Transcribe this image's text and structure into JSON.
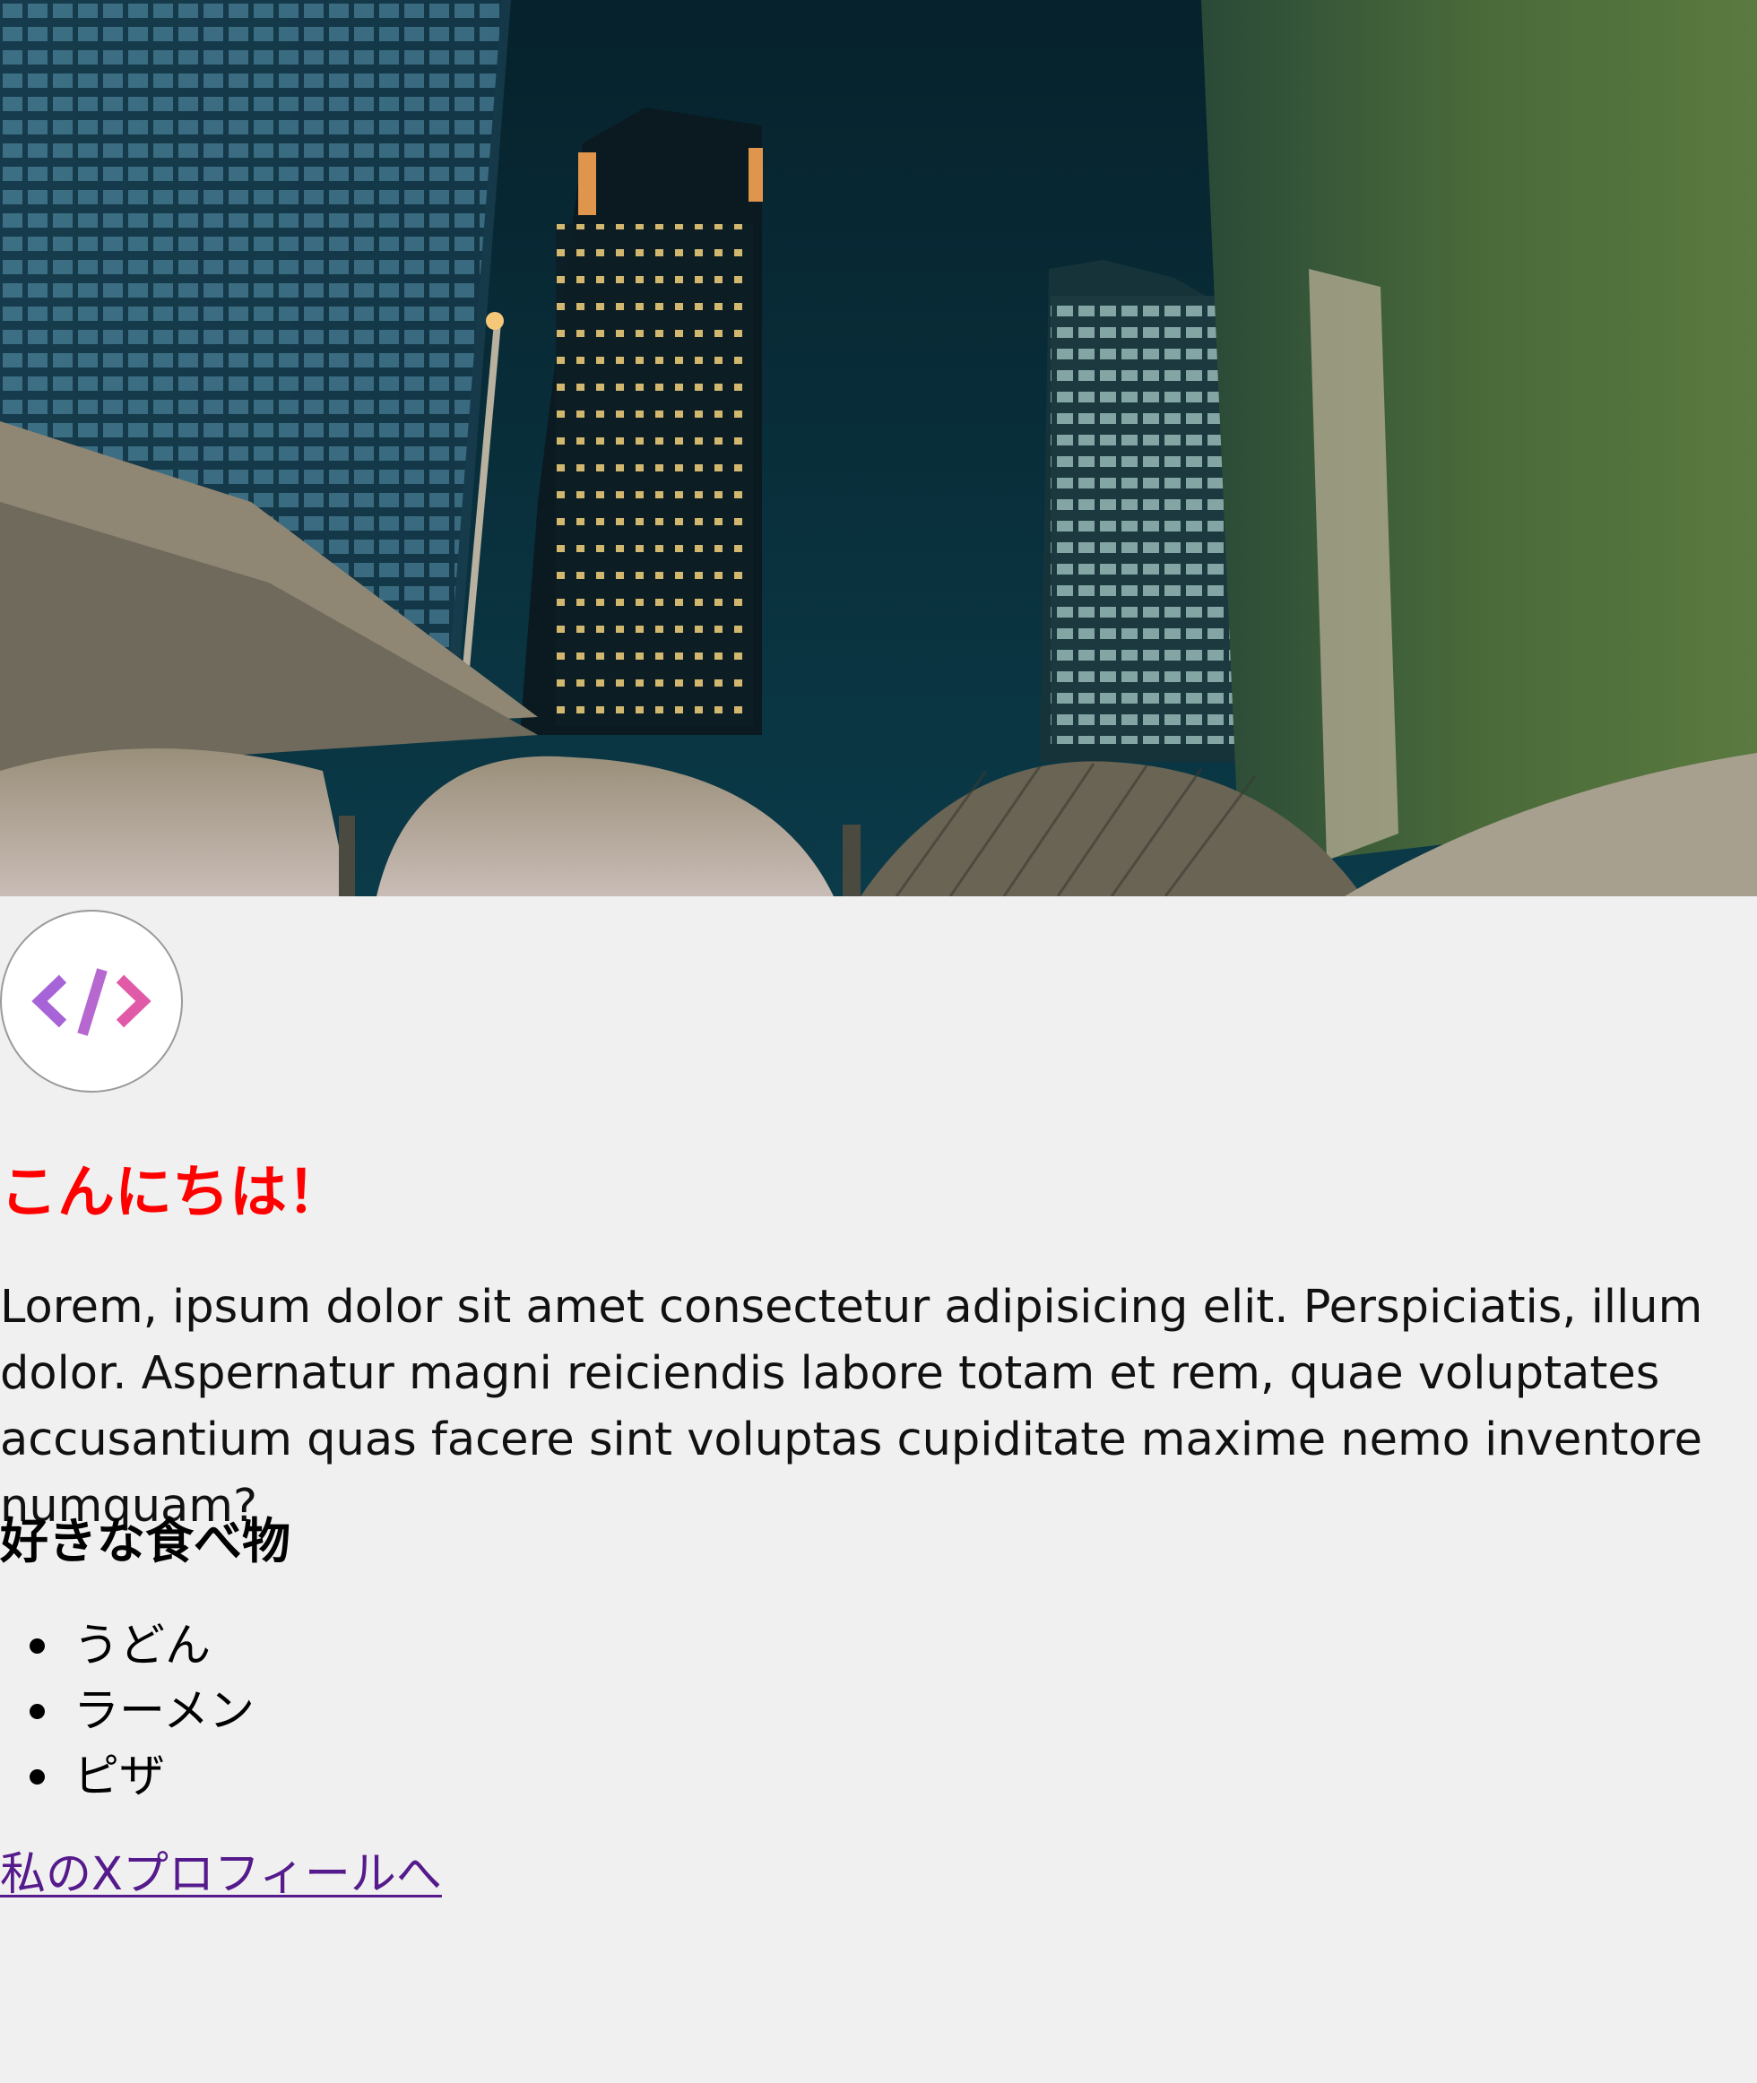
{
  "hero": {
    "image": "night-city-skyline-photo"
  },
  "avatar": {
    "icon": "code-brackets-icon",
    "glyph": "</>",
    "colors": {
      "left_bracket": "#a763d8",
      "slash": "#b768d0",
      "right_bracket": "#e05aa8"
    }
  },
  "heading": "こんにちは！",
  "intro": "Lorem, ipsum dolor sit amet consectetur adipisicing elit. Perspiciatis, illum dolor. Aspernatur magni reiciendis labore totam et rem, quae voluptates accusantium quas facere sint voluptas cupiditate maxime nemo inventore numquam?",
  "favorites": {
    "heading": "好きな食べ物",
    "items": [
      "うどん",
      "ラーメン",
      "ピザ"
    ]
  },
  "link": {
    "label": "私のXプロフィールへ"
  },
  "colors": {
    "heading": "#ff0000",
    "link": "#551a8b",
    "background": "#f0f0f0"
  }
}
